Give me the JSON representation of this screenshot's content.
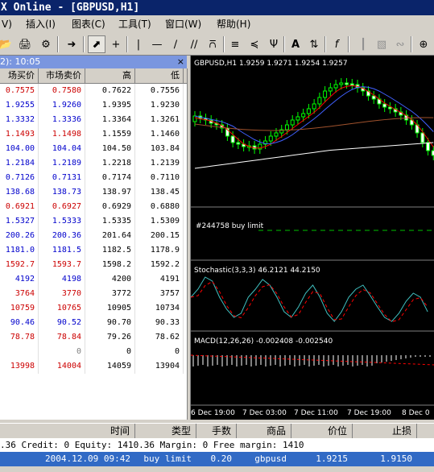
{
  "window": {
    "title": "X Online - [GBPUSD,H1]"
  },
  "menu": [
    {
      "label": "V)"
    },
    {
      "label": "插入(I)"
    },
    {
      "label": "图表(C)"
    },
    {
      "label": "工具(T)"
    },
    {
      "label": "窗口(W)"
    },
    {
      "label": "帮助(H)"
    }
  ],
  "toolbar": {
    "icons": [
      "open-icon",
      "print-icon",
      "properties-icon",
      "expert-icon",
      "cursor-icon",
      "crosshair-icon",
      "vertical-line-icon",
      "horizontal-line-icon",
      "trendline-icon",
      "channel-icon",
      "gann-icon",
      "fibo-icon",
      "line-studies-icon",
      "pitchfork-icon",
      "text-icon",
      "arrows-icon",
      "indicator-icon",
      "bar-chart-icon",
      "candle-chart-icon",
      "line-chart-icon",
      "zoom-in-icon"
    ],
    "text_label": "A",
    "fx_label": "f"
  },
  "market_watch": {
    "header": "2): 10:05",
    "close": "×",
    "columns": [
      "场买价",
      "市场卖价",
      "高",
      "低"
    ],
    "rows": [
      {
        "bid": "0.7575",
        "ask": "0.7580",
        "high": "0.7622",
        "low": "0.7556",
        "color": "#cc0000"
      },
      {
        "bid": "1.9255",
        "ask": "1.9260",
        "high": "1.9395",
        "low": "1.9230",
        "color": "#0000cc"
      },
      {
        "bid": "1.3332",
        "ask": "1.3336",
        "high": "1.3364",
        "low": "1.3261",
        "color": "#0000cc"
      },
      {
        "bid": "1.1493",
        "ask": "1.1498",
        "high": "1.1559",
        "low": "1.1460",
        "color": "#cc0000"
      },
      {
        "bid": "104.00",
        "ask": "104.04",
        "high": "104.50",
        "low": "103.84",
        "color": "#0000cc"
      },
      {
        "bid": "1.2184",
        "ask": "1.2189",
        "high": "1.2218",
        "low": "1.2139",
        "color": "#0000cc"
      },
      {
        "bid": "0.7126",
        "ask": "0.7131",
        "high": "0.7174",
        "low": "0.7110",
        "color": "#0000cc"
      },
      {
        "bid": "138.68",
        "ask": "138.73",
        "high": "138.97",
        "low": "138.45",
        "color": "#0000cc"
      },
      {
        "bid": "0.6921",
        "ask": "0.6927",
        "high": "0.6929",
        "low": "0.6880",
        "color": "#cc0000"
      },
      {
        "bid": "1.5327",
        "ask": "1.5333",
        "high": "1.5335",
        "low": "1.5309",
        "color": "#0000cc"
      },
      {
        "bid": "200.26",
        "ask": "200.36",
        "high": "201.64",
        "low": "200.15",
        "color": "#0000cc"
      },
      {
        "bid": "1181.0",
        "ask": "1181.5",
        "high": "1182.5",
        "low": "1178.9",
        "color": "#0000cc"
      },
      {
        "bid": "1592.7",
        "ask": "1593.7",
        "high": "1598.2",
        "low": "1592.2",
        "color": "#cc0000"
      },
      {
        "bid": "4192",
        "ask": "4198",
        "high": "4200",
        "low": "4191",
        "color": "#0000cc"
      },
      {
        "bid": "3764",
        "ask": "3770",
        "high": "3772",
        "low": "3757",
        "color": "#cc0000"
      },
      {
        "bid": "10759",
        "ask": "10765",
        "high": "10905",
        "low": "10734",
        "color": "#cc0000"
      },
      {
        "bid": "90.46",
        "ask": "90.52",
        "high": "90.70",
        "low": "90.33",
        "color": "#0000cc"
      },
      {
        "bid": "78.78",
        "ask": "78.84",
        "high": "79.26",
        "low": "78.62",
        "color": "#cc0000"
      },
      {
        "bid": "",
        "ask": "0",
        "high": "0",
        "low": "0",
        "color": "#808080"
      },
      {
        "bid": "13998",
        "ask": "14004",
        "high": "14059",
        "low": "13904",
        "color": "#cc0000"
      }
    ]
  },
  "chart": {
    "title": "GBPUSD,H1  1.9259 1.9271 1.9254 1.9257",
    "order_label": "#244758 buy limit",
    "stoch_label": "Stochastic(3,3,3)  46.2121  44.2150",
    "macd_label": "MACD(12,26,26)  -0.002408  -0.002540",
    "time_labels": [
      "6 Dec 19:00",
      "7 Dec 03:00",
      "7 Dec 11:00",
      "7 Dec 19:00",
      "8 Dec 0"
    ],
    "colors": {
      "bull": "#00ff00",
      "ma_fast": "#ff0000",
      "ma_mid": "#4060ff",
      "ma_slow": "#ffffff",
      "ma_brown": "#a0522d",
      "stoch_main": "#40c0c0",
      "stoch_signal": "#ff0000",
      "order_line": "#00c000"
    }
  },
  "terminal": {
    "columns": [
      "时间",
      "类型",
      "手数",
      "商品",
      "价位",
      "止损"
    ],
    "balance": ".36  Credit: 0  Equity: 1410.36  Margin: 0 Free margin: 1410",
    "order": {
      "time": "2004.12.09 09:42",
      "type": "buy limit",
      "lots": "0.20",
      "symbol": "gbpusd",
      "price": "1.9215",
      "sl": "1.9150"
    }
  },
  "chart_data": {
    "type": "candlestick",
    "title": "GBPUSD,H1",
    "ohlc_last": [
      1.9259,
      1.9271,
      1.9254,
      1.9257
    ],
    "x": [
      "6 Dec 19:00",
      "7 Dec 03:00",
      "7 Dec 11:00",
      "7 Dec 19:00",
      "8 Dec 0"
    ],
    "series": [
      {
        "name": "Stochastic(3,3,3)",
        "values": [
          46.2121,
          44.215
        ]
      },
      {
        "name": "MACD(12,26,26)",
        "values": [
          -0.002408,
          -0.00254
        ]
      }
    ]
  }
}
